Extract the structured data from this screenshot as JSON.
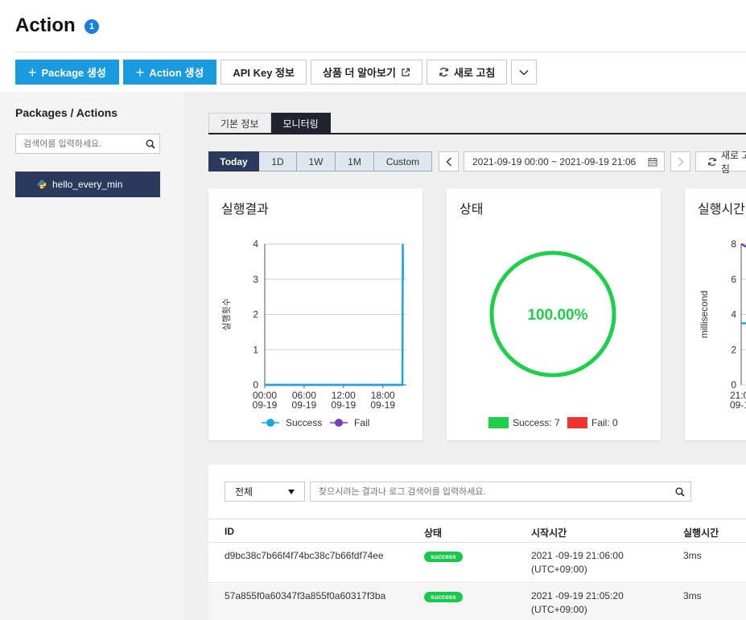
{
  "header": {
    "title": "Action",
    "count": "1"
  },
  "toolbar": {
    "package_create": "Package 생성",
    "action_create": "Action 생성",
    "api_key": "API Key 정보",
    "learn_more": "상품 더 알아보기",
    "refresh": "새로 고침"
  },
  "sidebar": {
    "title": "Packages / Actions",
    "search_placeholder": "검색어를 입력하세요.",
    "items": [
      {
        "label": "hello_every_min",
        "icon": "python-icon"
      }
    ]
  },
  "tabs": [
    {
      "label": "기본 정보",
      "active": false
    },
    {
      "label": "모니터링",
      "active": true
    }
  ],
  "range": {
    "options": [
      "Today",
      "1D",
      "1W",
      "1M",
      "Custom"
    ],
    "active": "Today",
    "date_range": "2021-09-19 00:00 ~ 2021-09-19 21:06",
    "refresh": "새로 고침"
  },
  "cards": {
    "result_title": "실행결과",
    "status_title": "상태",
    "duration_title": "실행시간"
  },
  "chart_data": [
    {
      "type": "line",
      "title": "실행결과",
      "ylabel": "실행횟수",
      "xlabel": "",
      "x_ticks": [
        "00:00\n09-19",
        "06:00\n09-19",
        "12:00\n09-19",
        "18:00\n09-19"
      ],
      "ylim": [
        0,
        4
      ],
      "y_ticks": [
        0,
        1,
        2,
        3,
        4
      ],
      "series": [
        {
          "name": "Success",
          "color": "#1ba6e0",
          "points": [
            [
              0,
              0
            ],
            [
              21.0,
              0
            ],
            [
              21.05,
              4
            ],
            [
              21.1,
              3
            ]
          ]
        },
        {
          "name": "Fail",
          "color": "#7b3fb0",
          "points": [
            [
              0,
              0
            ],
            [
              21.1,
              0
            ]
          ]
        }
      ],
      "grid": true,
      "legend": "bottom"
    },
    {
      "type": "pie",
      "title": "상태",
      "center_label": "100.00%",
      "slices": [
        {
          "name": "Success",
          "value": 7,
          "color": "#1ecf4a"
        },
        {
          "name": "Fail",
          "value": 0,
          "color": "#ee3333"
        }
      ],
      "legend_labels": [
        "Success: 7",
        "Fail: 0"
      ],
      "legend": "bottom"
    },
    {
      "type": "line",
      "title": "실행시간",
      "ylabel": "millisecond",
      "ylim": [
        0,
        8
      ],
      "y_ticks": [
        0,
        2,
        4,
        6,
        8
      ],
      "x_ticks": [
        "21:0",
        "09-1"
      ],
      "series": [
        {
          "name": "",
          "color": "#7b3fb0",
          "values": [
            8,
            7.5
          ]
        },
        {
          "name": "",
          "color": "#1ba6e0",
          "values": [
            3.5,
            3.5
          ]
        }
      ]
    }
  ],
  "log_table": {
    "filter_value": "전체",
    "search_placeholder": "찾으시려는 결과나 로그 검색어를 입력하세요.",
    "columns": [
      "ID",
      "상태",
      "시작시간",
      "실행시간"
    ],
    "rows": [
      {
        "id": "d9bc38c7b66f4f74bc38c7b66fdf74ee",
        "status": "success",
        "start_date": "2021 -09-19 21:06:00",
        "start_tz": "(UTC+09:00)",
        "duration": "3ms"
      },
      {
        "id": "57a855f0a60347f3a855f0a60317f3ba",
        "status": "success",
        "start_date": "2021 -09-19 21:05:20",
        "start_tz": "(UTC+09:00)",
        "duration": "3ms"
      }
    ]
  }
}
